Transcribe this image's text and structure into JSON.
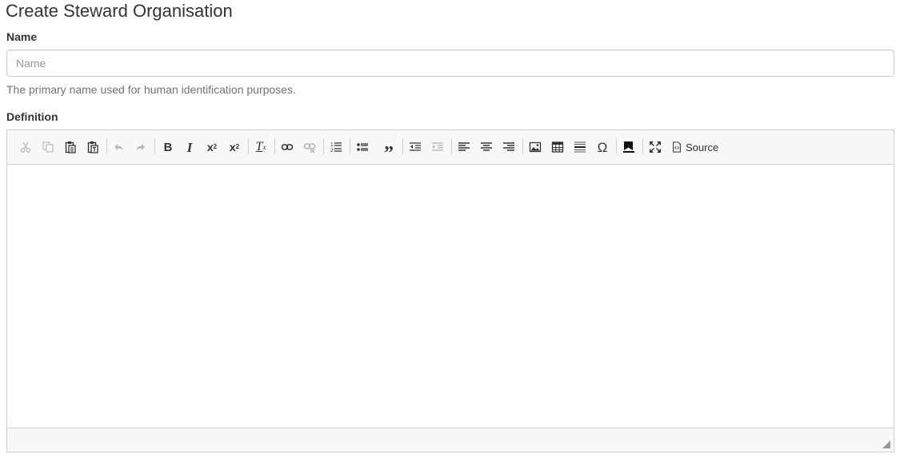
{
  "page": {
    "title": "Create Steward Organisation"
  },
  "form": {
    "name": {
      "label": "Name",
      "placeholder": "Name",
      "value": "",
      "help": "The primary name used for human identification purposes."
    },
    "definition": {
      "label": "Definition",
      "content": ""
    }
  },
  "editor": {
    "toolbar": {
      "icons": [
        "cut-icon",
        "copy-icon",
        "paste-icon",
        "paste-text-icon",
        "undo-icon",
        "redo-icon",
        "bold-icon",
        "italic-icon",
        "subscript-icon",
        "superscript-icon",
        "remove-format-icon",
        "link-icon",
        "unlink-icon",
        "numbered-list-icon",
        "bulleted-list-icon",
        "blockquote-icon",
        "outdent-icon",
        "indent-icon",
        "align-left-icon",
        "align-center-icon",
        "align-right-icon",
        "image-icon",
        "table-icon",
        "horizontal-line-icon",
        "special-char-icon",
        "bookmark-icon",
        "maximize-icon",
        "source-icon"
      ],
      "source_label": "Source"
    }
  },
  "colors": {
    "text": "#333333",
    "muted_text": "#737373",
    "placeholder": "#999999",
    "border": "#cccccc",
    "toolbar_bg": "#f8f8f8"
  }
}
